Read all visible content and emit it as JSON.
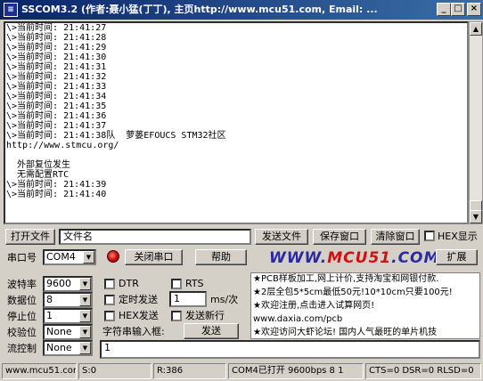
{
  "window": {
    "icon_label": "≡",
    "title": "SSCOM3.2 (作者:聂小猛(丁丁), 主页http://www.mcu51.com,  Email: ...",
    "minimize": "_",
    "maximize": "□",
    "close": "×"
  },
  "console_lines": [
    "\\>当前时间: 21:41:27",
    "\\>当前时间: 21:41:28",
    "\\>当前时间: 21:41:29",
    "\\>当前时间: 21:41:30",
    "\\>当前时间: 21:41:31",
    "\\>当前时间: 21:41:32",
    "\\>当前时间: 21:41:33",
    "\\>当前时间: 21:41:34",
    "\\>当前时间: 21:41:35",
    "\\>当前时间: 21:41:36",
    "\\>当前时间: 21:41:37",
    "\\>当前时间: 21:41:38队  萝蒌EFOUCS STM32社区",
    "http://www.stmcu.org/",
    "",
    "  外部复位发生",
    "  无需配置RTC",
    "\\>当前时间: 21:41:39",
    "\\>当前时间: 21:41:40"
  ],
  "scrollbar": {
    "up": "▲",
    "down": "▼"
  },
  "file_row": {
    "open_file": "打开文件",
    "filename": "文件名",
    "send_file": "发送文件",
    "save_window": "保存窗口",
    "clear_window": "清除窗口",
    "hex_display": "HEX显示"
  },
  "port_row": {
    "port_label": "串口号",
    "port_value": "COM4",
    "close_port": "关闭串口",
    "help": "帮助",
    "logo_blue_1": "WWW.",
    "logo_red": "MCU51",
    "logo_blue_2": ".COM",
    "expand": "扩展"
  },
  "settings": {
    "baud_label": "波特率",
    "baud_value": "9600",
    "data_label": "数据位",
    "data_value": "8",
    "stop_label": "停止位",
    "stop_value": "1",
    "parity_label": "校验位",
    "parity_value": "None",
    "flow_label": "流控制",
    "flow_value": "None"
  },
  "options": {
    "dtr": "DTR",
    "rts": "RTS",
    "timed_send": "定时发送",
    "interval": "1",
    "interval_unit": "ms/次",
    "hex_send": "HEX发送",
    "send_newline": "发送新行",
    "input_label": "字符串输入框:",
    "send": "发送",
    "send_input": "1"
  },
  "ad_lines": [
    "★PCB样板加工,网上计价,支持淘宝和网银付款.",
    "★2层全包5*5cm最低50元!10*10cm只要100元!",
    "★欢迎注册,点击进入试算网页!",
    "www.daxia.com/pcb",
    "★欢迎访问大虾论坛! 国内人气最旺的单片机技"
  ],
  "statusbar": {
    "site": "www.mcu51.com",
    "sent": "S:0",
    "received": "R:386",
    "port_status": "COM4已打开  9600bps  8 1",
    "signals": "CTS=0 DSR=0 RLSD=0"
  }
}
